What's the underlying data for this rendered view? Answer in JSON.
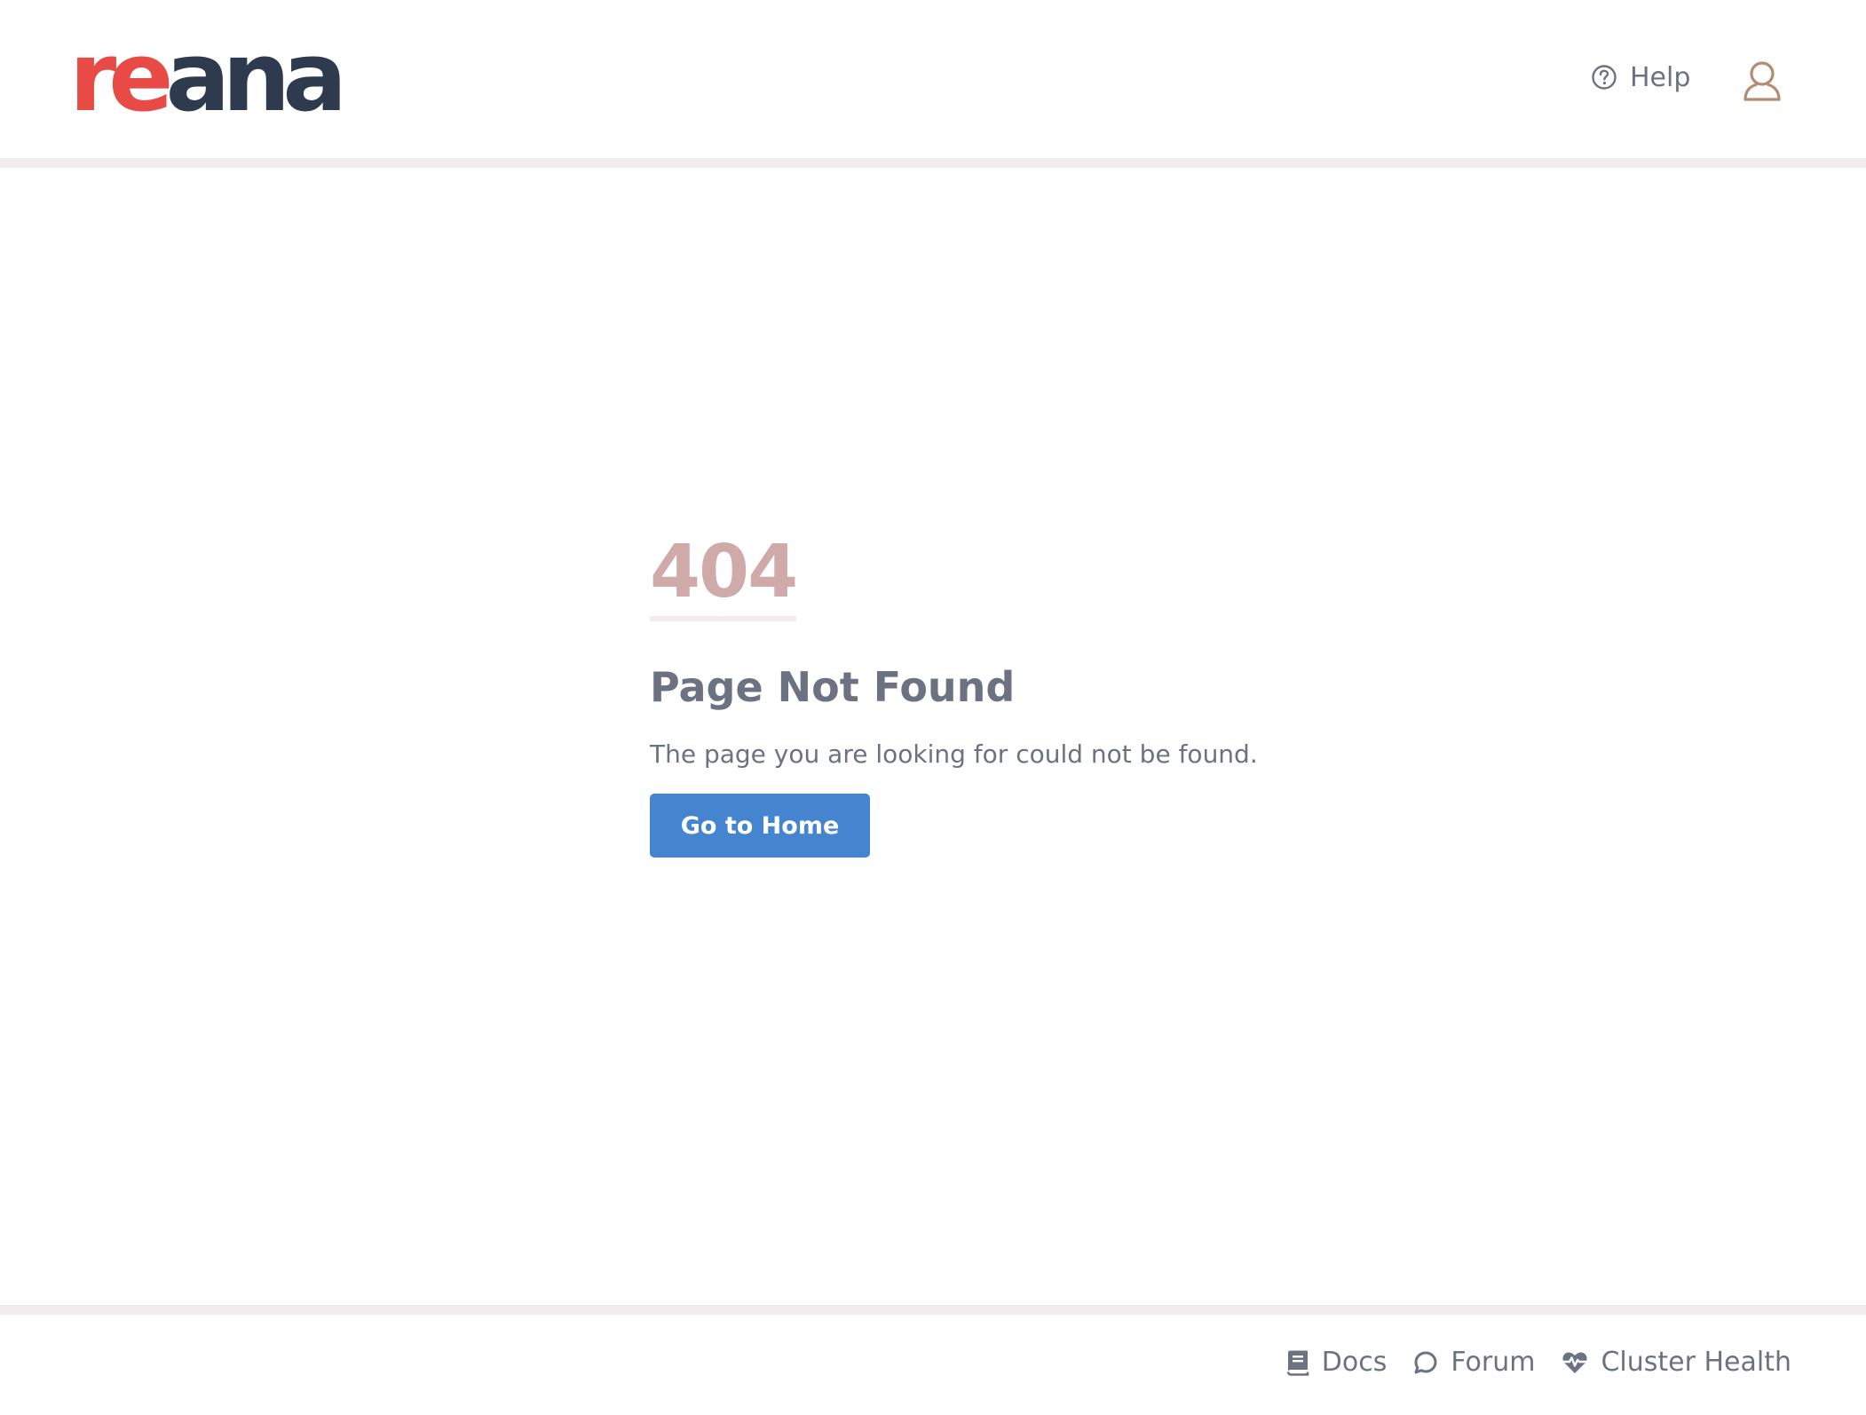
{
  "header": {
    "logo": {
      "part_1": "re",
      "part_2": "ana"
    },
    "help_label": "Help"
  },
  "main": {
    "error_code": "404",
    "title": "Page Not Found",
    "message": "The page you are looking for could not be found.",
    "button_label": "Go to Home"
  },
  "footer": {
    "links": [
      {
        "label": "Docs",
        "icon": "book-icon"
      },
      {
        "label": "Forum",
        "icon": "chat-bubble-icon"
      },
      {
        "label": "Cluster Health",
        "icon": "heart-pulse-icon"
      }
    ]
  },
  "colors": {
    "logo_red": "#e84b45",
    "logo_dark": "#2e3a4d",
    "text_gray": "#6b7382",
    "error_code": "#d0a9a9",
    "divider": "#f1ecee",
    "button_blue": "#4584cf",
    "user_icon": "#b58c72"
  }
}
